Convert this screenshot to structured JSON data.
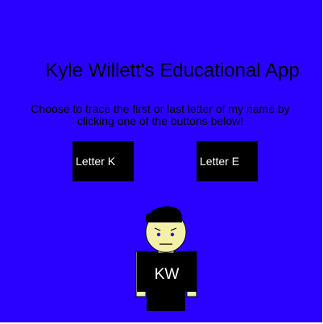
{
  "app": {
    "title": "Kyle Willett's Educational App",
    "instructions": "Choose to trace the first or last letter of my name by clicking one of the buttons below!"
  },
  "buttons": {
    "letter_k": "Letter K",
    "letter_e": "Letter E"
  },
  "character": {
    "shirt_text": "KW"
  },
  "colors": {
    "background": "#2a00ff",
    "button": "#000000",
    "button_text": "#ffffff",
    "skin": "#f5f0a8",
    "eyes": "#2a00ff"
  }
}
